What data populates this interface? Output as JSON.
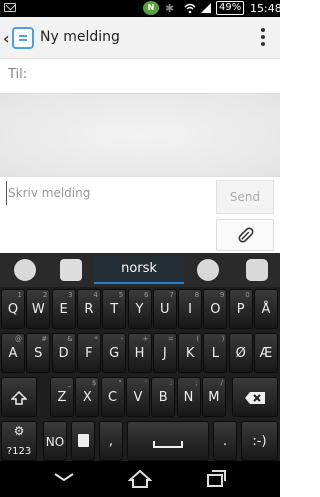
{
  "status_bar": {
    "nfc": "N",
    "battery": "49%",
    "time": "15:48",
    "icons": [
      "mail-icon",
      "bluetooth-icon",
      "wifi-icon",
      "signal-icon",
      "battery-icon"
    ]
  },
  "header": {
    "title": "Ny melding"
  },
  "recipient": {
    "label": "Til:"
  },
  "compose": {
    "placeholder": "Skriv melding",
    "send_label": "Send",
    "attach_icon": "paperclip-icon"
  },
  "keyboard": {
    "language": "norsk",
    "row1": [
      {
        "k": "Q",
        "h": "1"
      },
      {
        "k": "W",
        "h": "2"
      },
      {
        "k": "E",
        "h": "3"
      },
      {
        "k": "R",
        "h": "4"
      },
      {
        "k": "T",
        "h": "5"
      },
      {
        "k": "Y",
        "h": "6"
      },
      {
        "k": "U",
        "h": "7"
      },
      {
        "k": "I",
        "h": "8"
      },
      {
        "k": "O",
        "h": "9"
      },
      {
        "k": "P",
        "h": "0"
      },
      {
        "k": "Å",
        "h": ""
      }
    ],
    "row2": [
      {
        "k": "A",
        "h": "@"
      },
      {
        "k": "S",
        "h": "#"
      },
      {
        "k": "D",
        "h": "&"
      },
      {
        "k": "F",
        "h": "*"
      },
      {
        "k": "G",
        "h": "-"
      },
      {
        "k": "H",
        "h": "+"
      },
      {
        "k": "J",
        "h": "="
      },
      {
        "k": "K",
        "h": "("
      },
      {
        "k": "L",
        "h": ")"
      },
      {
        "k": "Ø",
        "h": ""
      },
      {
        "k": "Æ",
        "h": ""
      }
    ],
    "row3": [
      {
        "k": "Z",
        "h": "_"
      },
      {
        "k": "X",
        "h": "$"
      },
      {
        "k": "C",
        "h": "\""
      },
      {
        "k": "V",
        "h": "'"
      },
      {
        "k": "B",
        "h": ":"
      },
      {
        "k": "N",
        "h": ";"
      },
      {
        "k": "M",
        "h": "/"
      }
    ],
    "sym_label": "?123",
    "lang_key": "NO",
    "comma": ",",
    "period": ".",
    "smiley": ":-)"
  }
}
